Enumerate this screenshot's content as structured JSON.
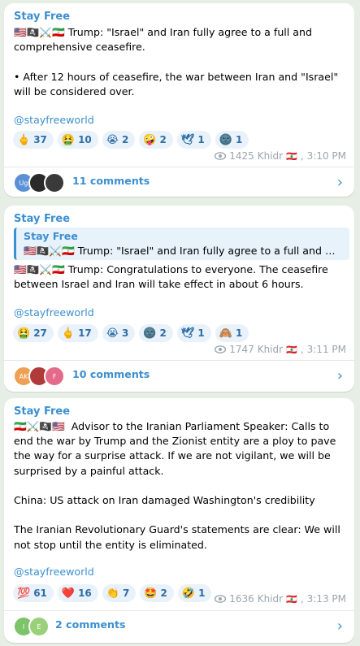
{
  "posts": [
    {
      "sender": "Stay Free",
      "text": "🇺🇸🏴‍☠️⚔️🇮🇷 Trump: \"Israel\" and Iran fully agree to a full and comprehensive ceasefire.\n\n• After 12 hours of ceasefire, the war between Iran and \"Israel\" will be considered over.",
      "handle": "@stayfreeworld",
      "reactions": [
        {
          "emoji": "🖕",
          "count": "37"
        },
        {
          "emoji": "🤮",
          "count": "10"
        },
        {
          "emoji": "😭",
          "count": "2"
        },
        {
          "emoji": "🤪",
          "count": "2"
        },
        {
          "emoji": "🕊",
          "count": "1"
        },
        {
          "emoji": "🌚",
          "count": "1"
        }
      ],
      "views": "1425",
      "author": "Khidr",
      "flag": "🇱🇧",
      "time": "3:10 PM",
      "avatars": [
        "Ug",
        "",
        ""
      ],
      "comments": "11 comments"
    },
    {
      "sender": "Stay Free",
      "quote_sender": "Stay Free",
      "quote_text": "🇺🇸🏴‍☠️⚔️🇮🇷 Trump: \"Israel\" and Iran fully agree to a full and co...",
      "text": "🇺🇸🏴‍☠️⚔️🇮🇷 Trump: Congratulations to everyone. The ceasefire between Israel and Iran will take effect in about 6 hours.",
      "handle": "@stayfreeworld",
      "reactions": [
        {
          "emoji": "🤮",
          "count": "27"
        },
        {
          "emoji": "🖕",
          "count": "17"
        },
        {
          "emoji": "😭",
          "count": "3"
        },
        {
          "emoji": "🌚",
          "count": "2"
        },
        {
          "emoji": "🕊",
          "count": "1"
        },
        {
          "emoji": "🙈",
          "count": "1"
        }
      ],
      "views": "1747",
      "author": "Khidr",
      "flag": "🇱🇧",
      "time": "3:11 PM",
      "avatars": [
        "AK",
        "",
        "F"
      ],
      "comments": "10 comments"
    },
    {
      "sender": "Stay Free",
      "text": "🇮🇷⚔️🏴‍☠️🇺🇸  Advisor to the Iranian Parliament Speaker: Calls to end the war by Trump and the Zionist entity are a ploy to pave the way for a surprise attack. If we are not vigilant, we will be surprised by a painful attack.\n\nChina: US attack on Iran damaged Washington's credibility\n\nThe Iranian Revolutionary Guard's statements are clear: We will not stop until the entity is eliminated.",
      "handle": "@stayfreeworld",
      "reactions": [
        {
          "emoji": "💯",
          "count": "61"
        },
        {
          "emoji": "❤️",
          "count": "16"
        },
        {
          "emoji": "👏",
          "count": "7"
        },
        {
          "emoji": "🤩",
          "count": "2"
        },
        {
          "emoji": "🤣",
          "count": "1"
        }
      ],
      "views": "1636",
      "author": "Khidr",
      "flag": "🇱🇧",
      "time": "3:13 PM",
      "avatars": [
        "I",
        "E"
      ],
      "comments": "2 comments"
    }
  ],
  "icons": {
    "eye": "eye-icon",
    "chevron": "chevron-right-icon"
  },
  "colors": {
    "accent": "#3c8fd0",
    "background": "#e6eee6",
    "reaction_bg": "#e9f2fb"
  }
}
